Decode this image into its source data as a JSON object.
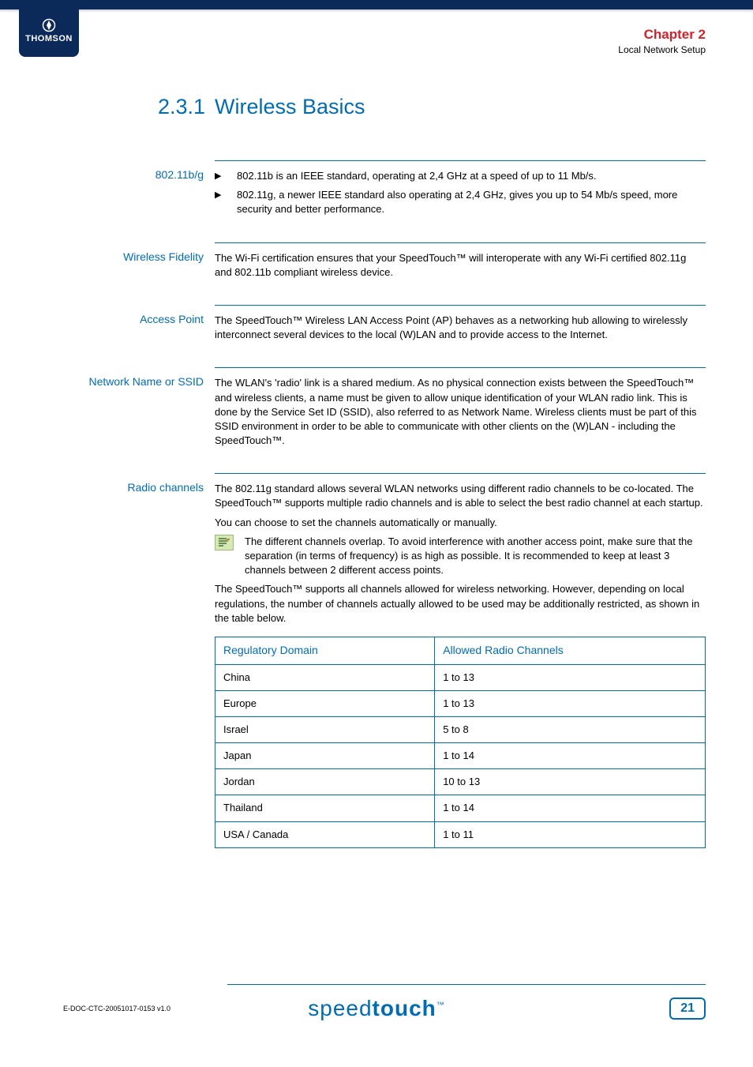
{
  "header": {
    "brand": "THOMSON",
    "chapter_num": "Chapter 2",
    "chapter_title": "Local Network Setup"
  },
  "heading": {
    "number": "2.3.1",
    "title": "Wireless Basics"
  },
  "sections": {
    "s1": {
      "label": "802.11b/g",
      "b1": "802.11b is an IEEE standard, operating at 2,4 GHz at a speed of up to 11 Mb/s.",
      "b2": "802.11g, a newer IEEE standard also operating at 2,4 GHz, gives you up to 54 Mb/s speed, more security and better performance."
    },
    "s2": {
      "label": "Wireless Fidelity",
      "p1": "The Wi-Fi certification ensures that your SpeedTouch™ will interoperate with any Wi-Fi certified 802.11g and 802.11b compliant wireless device."
    },
    "s3": {
      "label": "Access Point",
      "p1": "The SpeedTouch™ Wireless LAN Access Point (AP) behaves as a networking hub allowing to wirelessly interconnect several devices to the local (W)LAN and to provide access to the Internet."
    },
    "s4": {
      "label": "Network Name or SSID",
      "p1": "The WLAN's 'radio' link is a shared medium. As no physical connection exists between the SpeedTouch™ and wireless clients, a name must be given to allow unique identification of your WLAN radio link. This is done by the Service Set ID (SSID), also referred to as Network Name. Wireless clients must be part of this SSID environment in order to be able to communicate with other clients on the (W)LAN - including the SpeedTouch™."
    },
    "s5": {
      "label": "Radio channels",
      "p1": "The 802.11g standard allows several WLAN networks using different radio channels to be co-located. The SpeedTouch™ supports multiple radio channels and is able to select the best radio channel at each startup.",
      "p2": "You can choose to set the channels automatically or manually.",
      "note": "The different channels overlap. To avoid interference with another access point, make sure that the separation (in terms of frequency) is as high as possible. It is recommended to keep at least 3 channels between 2 different access points.",
      "p3": "The SpeedTouch™ supports all channels allowed for wireless networking. However, depending on local regulations, the number of channels actually allowed to be used may be additionally restricted, as shown in the table below."
    }
  },
  "chart_data": {
    "type": "table",
    "title": "Allowed Radio Channels by Regulatory Domain",
    "headers": [
      "Regulatory Domain",
      "Allowed Radio Channels"
    ],
    "rows": [
      {
        "domain": "China",
        "channels": "1 to 13"
      },
      {
        "domain": "Europe",
        "channels": "1 to 13"
      },
      {
        "domain": "Israel",
        "channels": "5 to 8"
      },
      {
        "domain": "Japan",
        "channels": "1 to 14"
      },
      {
        "domain": "Jordan",
        "channels": "10 to 13"
      },
      {
        "domain": "Thailand",
        "channels": "1 to 14"
      },
      {
        "domain": "USA / Canada",
        "channels": "1 to 11"
      }
    ]
  },
  "footer": {
    "doc_id": "E-DOC-CTC-20051017-0153 v1.0",
    "logo_light": "speed",
    "logo_bold": "touch",
    "tm": "™",
    "page": "21"
  }
}
